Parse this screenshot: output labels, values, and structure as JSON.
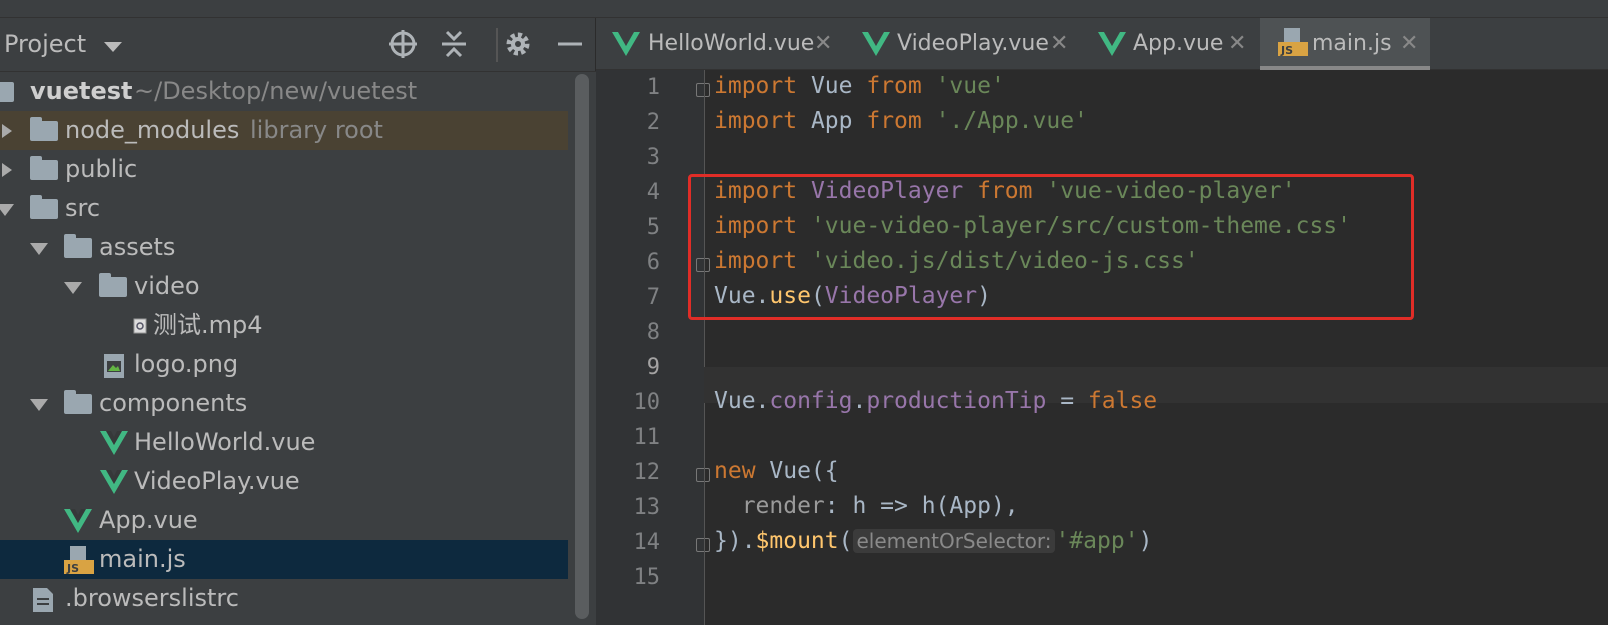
{
  "project_panel": {
    "title": "Project",
    "tree": [
      {
        "label": "vuetest",
        "path": "~/Desktop/new/vuetest"
      },
      {
        "label": "node_modules",
        "note": "library root"
      },
      {
        "label": "public"
      },
      {
        "label": "src"
      },
      {
        "label": "assets"
      },
      {
        "label": "video"
      },
      {
        "label": "测试.mp4"
      },
      {
        "label": "logo.png"
      },
      {
        "label": "components"
      },
      {
        "label": "HelloWorld.vue"
      },
      {
        "label": "VideoPlay.vue"
      },
      {
        "label": "App.vue"
      },
      {
        "label": "main.js"
      },
      {
        "label": ".browserslistrc"
      }
    ]
  },
  "tabs": [
    {
      "label": "HelloWorld.vue"
    },
    {
      "label": "VideoPlay.vue"
    },
    {
      "label": "App.vue"
    },
    {
      "label": "main.js"
    }
  ],
  "editor": {
    "line_numbers": [
      "1",
      "2",
      "3",
      "4",
      "5",
      "6",
      "7",
      "8",
      "9",
      "10",
      "11",
      "12",
      "13",
      "14",
      "15"
    ],
    "lines": {
      "l1": {
        "kw1": "import",
        "id": " Vue ",
        "kw2": "from",
        "str": " 'vue'"
      },
      "l2": {
        "kw1": "import",
        "id": " App ",
        "kw2": "from",
        "str": " './App.vue'"
      },
      "l4": {
        "kw1": "import",
        "id": " VideoPlayer ",
        "kw2": "from",
        "str": " 'vue-video-player'"
      },
      "l5": {
        "kw1": "import",
        "str": " 'vue-video-player/src/custom-theme.css'"
      },
      "l6": {
        "kw1": "import",
        "str": " 'video.js/dist/video-js.css'"
      },
      "l7": {
        "obj": "Vue.",
        "fn": "use",
        "p1": "(",
        "arg": "VideoPlayer",
        "p2": ")"
      },
      "l10": {
        "obj": "Vue.",
        "prop1": "config",
        "dot": ".",
        "prop2": "productionTip",
        "eq": " = ",
        "kw": "false"
      },
      "l12": {
        "kw": "new",
        "rest": " Vue({"
      },
      "l13": {
        "prop": "  render",
        "rest": ": h => h(App),"
      },
      "l14": {
        "pre": "}).",
        "fn": "$mount",
        "p1": "(",
        "hint": "elementOrSelector:",
        "str": "'#app'",
        "p2": ")"
      }
    }
  }
}
